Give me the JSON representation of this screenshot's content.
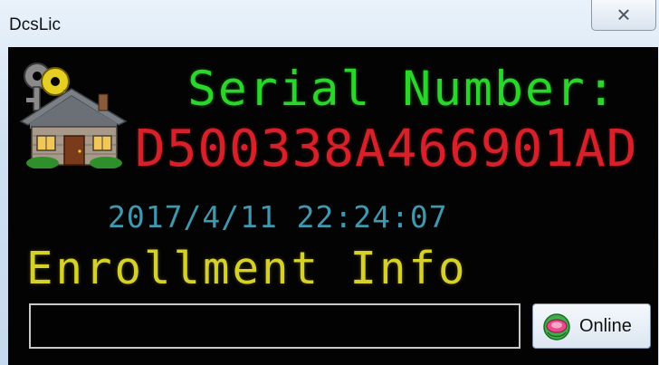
{
  "window": {
    "title": "DcsLic",
    "close_glyph": "✕"
  },
  "serial": {
    "label": "Serial Number:",
    "value": "D500338A466901AD"
  },
  "timestamp": {
    "text": "2017/4/11  22:24:07"
  },
  "enrollment": {
    "label": "Enrollment Info",
    "value": "",
    "online_button_label": "Online"
  },
  "icons": {
    "app": "house-with-key-icon",
    "online": "online-globe-icon",
    "close": "close-icon"
  },
  "colors": {
    "client_background": "#030303",
    "serial_label": "#2bd62b",
    "serial_value": "#d8202a",
    "timestamp": "#3f98ad",
    "enroll_label": "#d6d12a"
  }
}
